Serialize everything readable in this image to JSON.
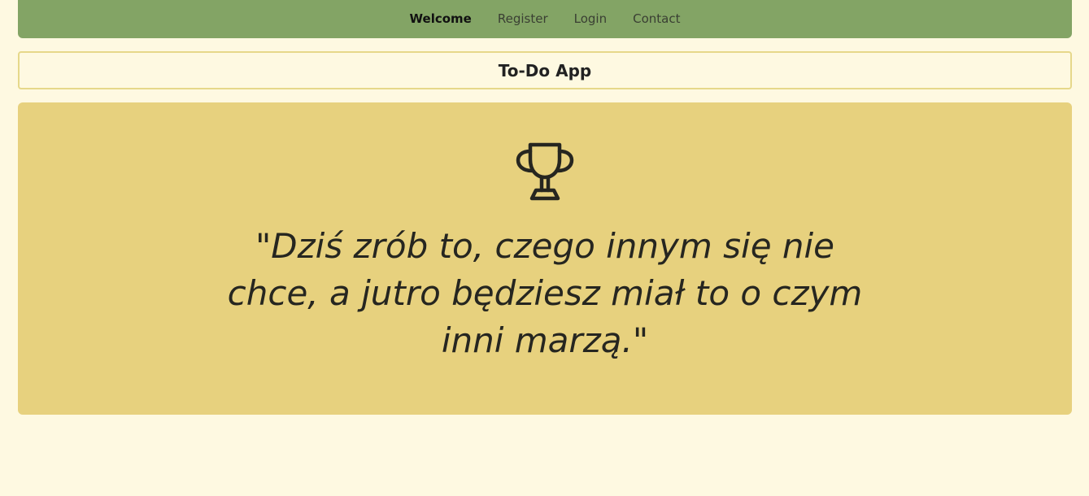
{
  "nav": {
    "items": [
      {
        "label": "Welcome",
        "active": true
      },
      {
        "label": "Register",
        "active": false
      },
      {
        "label": "Login",
        "active": false
      },
      {
        "label": "Contact",
        "active": false
      }
    ]
  },
  "header": {
    "title": "To-Do App"
  },
  "hero": {
    "icon": "trophy-icon",
    "quote": "\"Dziś zrób to, czego innym się nie chce, a jutro będziesz miał to o czym inni marzą.\""
  },
  "colors": {
    "background": "#fef9e1",
    "navbar": "#83a465",
    "hero": "#e7d17e",
    "title_border": "#e6d88a"
  }
}
